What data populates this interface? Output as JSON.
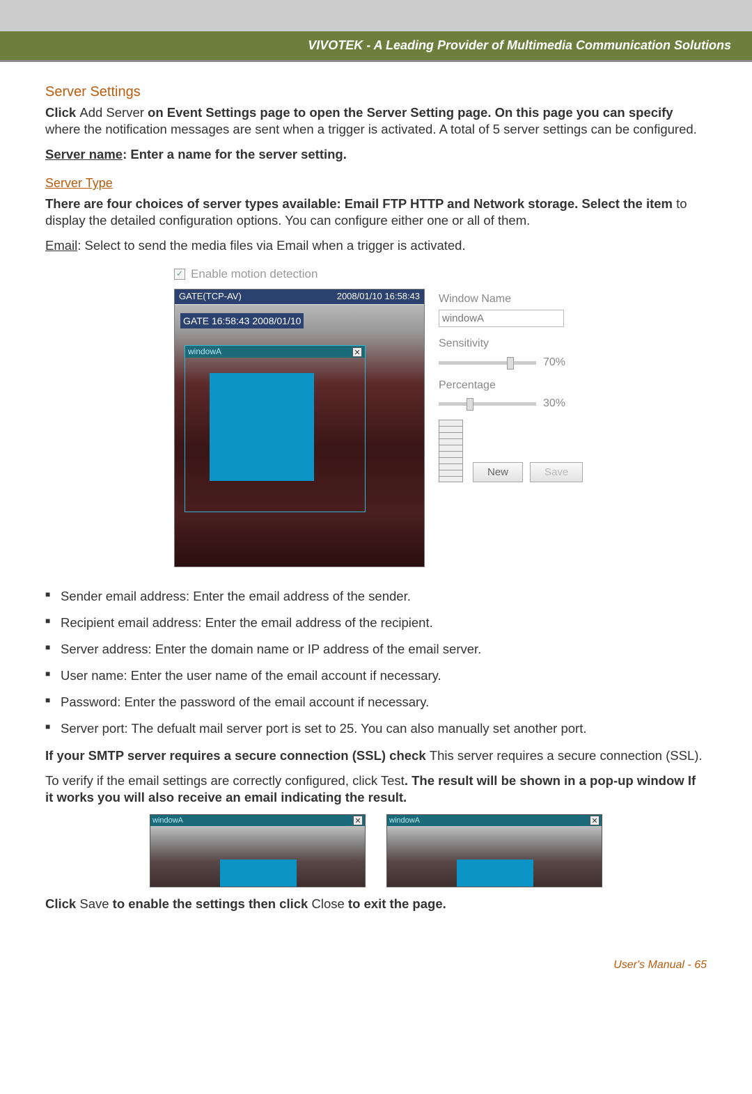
{
  "header": {
    "brand": "VIVOTEK - A Leading Provider of Multimedia Communication Solutions"
  },
  "section": {
    "title": "Server Settings",
    "intro_bold1": "Click ",
    "intro_plain1": "Add Server ",
    "intro_bold2": "on Event Settings page to open the Server Setting page. On this page you can specify ",
    "intro_plain2": "where the notification messages are sent when a trigger is activated. A total of 5 server settings can be configured.",
    "server_name_label": "Server name",
    "server_name_text": ": Enter a name for the server setting.",
    "server_type_title": "Server Type",
    "types_bold": "There are four choices of server types available: Email FTP HTTP and Network storage. Select the item ",
    "types_plain": "to display the detailed configuration options. You can configure either one or all of them.",
    "email_label": "Email",
    "email_text": ": Select to send the media files via Email when a trigger is activated."
  },
  "ui": {
    "enable_motion": "Enable motion detection",
    "title_left": "GATE(TCP-AV)",
    "title_right": "2008/01/10 16:58:43",
    "overlay": "GATE 16:58:43 2008/01/10",
    "subwin": "windowA",
    "window_name_lbl": "Window Name",
    "window_name_val": "windowA",
    "sensitivity_lbl": "Sensitivity",
    "sensitivity_val": "70%",
    "percentage_lbl": "Percentage",
    "percentage_val": "30%",
    "btn_new": "New",
    "btn_save": "Save"
  },
  "bullets": {
    "b1": "Sender email address: Enter the email address of the sender.",
    "b2": "Recipient email address: Enter the email address of the recipient.",
    "b3": "Server address: Enter the domain name or IP address of the email server.",
    "b4": "User name: Enter the user name of the email account if necessary.",
    "b5": "Password: Enter the password of the email account if necessary.",
    "b6": "Server port: The defualt mail server port is set to 25. You can also manually set another port."
  },
  "ssl": {
    "bold1": "If your SMTP server requires a secure connection (SSL) check ",
    "plain1": "This server requires a secure connection (SSL)."
  },
  "verify": {
    "plain1": "To verify if the email settings are correctly configured, click Test",
    "bold1": ". The result will be shown in a pop-up window If it works you will also receive an email indicating the result."
  },
  "test_win": {
    "title": "windowA"
  },
  "closing": {
    "bold1": "Click ",
    "plain1": "Save ",
    "bold2": "to enable the settings  then click ",
    "plain2": "Close ",
    "bold3": "to exit the page."
  },
  "footer": {
    "text": "User's Manual - 65"
  }
}
